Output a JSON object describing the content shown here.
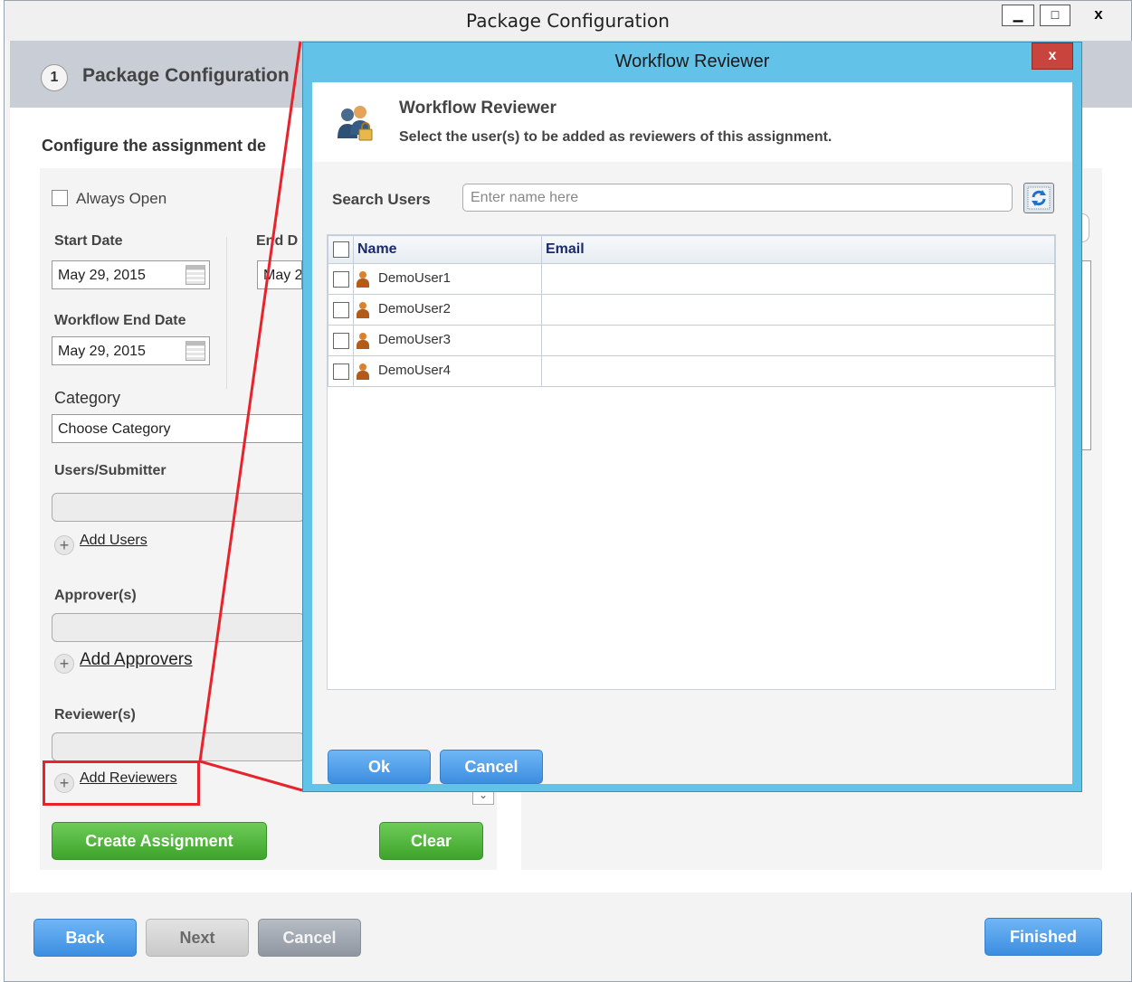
{
  "window": {
    "title": "Package Configuration",
    "minimize_glyph": "▁",
    "maximize_glyph": "□",
    "close_glyph": "x"
  },
  "step": {
    "number": "1",
    "title": "Package Configuration"
  },
  "form": {
    "heading": "Configure the assignment de",
    "always_open": "Always Open",
    "start_date_label": "Start Date",
    "start_date_value": "May 29, 2015",
    "end_date_label": "End D",
    "end_date_value": "May 2",
    "workflow_end_label": "Workflow End Date",
    "workflow_end_value": "May 29, 2015",
    "category_label": "Category",
    "category_value": "Choose Category",
    "users_label": "Users/Submitter",
    "add_users": "Add Users",
    "approvers_label": "Approver(s)",
    "add_approvers": "Add Approvers",
    "reviewers_label": "Reviewer(s)",
    "add_reviewers": "Add Reviewers",
    "create_assignment": "Create Assignment",
    "clear": "Clear"
  },
  "footer": {
    "back": "Back",
    "next": "Next",
    "cancel": "Cancel",
    "finished": "Finished"
  },
  "dialog": {
    "title": "Workflow Reviewer",
    "close_glyph": "x",
    "heading": "Workflow Reviewer",
    "subheading": "Select the user(s) to be added as reviewers of this assignment.",
    "search_label": "Search Users",
    "search_placeholder": "Enter name here",
    "columns": {
      "name": "Name",
      "email": "Email"
    },
    "users": [
      {
        "name": "DemoUser1",
        "email": ""
      },
      {
        "name": "DemoUser2",
        "email": ""
      },
      {
        "name": "DemoUser3",
        "email": ""
      },
      {
        "name": "DemoUser4",
        "email": ""
      }
    ],
    "ok": "Ok",
    "cancel": "Cancel"
  },
  "icons": {
    "calendar": "calendar-icon",
    "plus": "plus-icon",
    "user": "user-icon",
    "refresh": "refresh-icon",
    "reviewers": "reviewers-icon"
  },
  "colors": {
    "dialog_frame": "#62c2e8",
    "green_button": "#4fb63b",
    "blue_button": "#4e9ce8",
    "highlight": "#e8232b"
  }
}
